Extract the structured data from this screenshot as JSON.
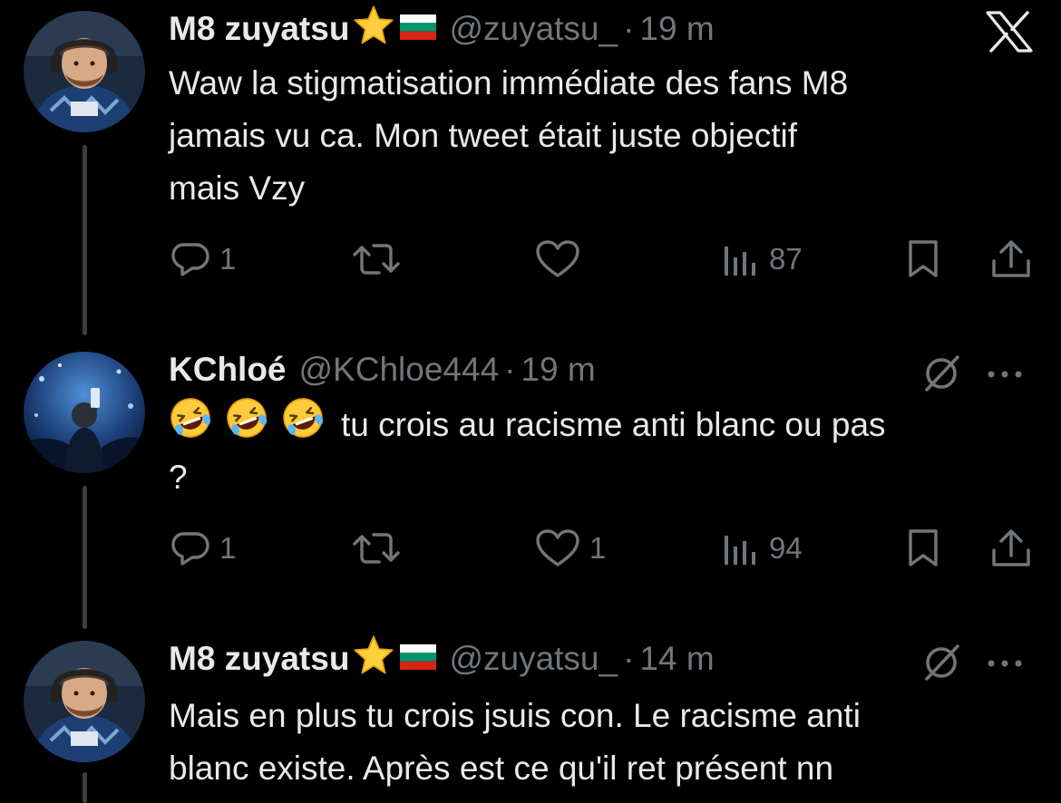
{
  "tweets": [
    {
      "name": "M8 zuyatsu",
      "handle": "@zuyatsu_",
      "separator": "·",
      "time": "19 m",
      "text_lines": [
        "Waw la stigmatisation immédiate des fans M8",
        "jamais vu ca. Mon tweet était juste objectif",
        "mais Vzy"
      ],
      "actions": {
        "replies": "1",
        "retweets": "",
        "likes": "",
        "views": "87"
      },
      "top_right_icon": "x-logo-icon"
    },
    {
      "name": "KChloé",
      "handle": "@KChloe444",
      "separator": "·",
      "time": "19 m",
      "emoji": [
        "🤣",
        "🤣",
        "🤣"
      ],
      "text_lines": [
        "tu crois au racisme anti blanc ou pas",
        "?"
      ],
      "actions": {
        "replies": "1",
        "retweets": "",
        "likes": "1",
        "views": "94"
      },
      "top_right_icon": "grok-icon"
    },
    {
      "name": "M8 zuyatsu",
      "handle": "@zuyatsu_",
      "separator": "·",
      "time": "14 m",
      "text_lines": [
        "Mais en plus tu crois jsuis con. Le racisme anti",
        "blanc existe. Après est ce qu'il ret présent nn"
      ],
      "top_right_icon": "grok-icon"
    }
  ],
  "colors": {
    "background": "#000000",
    "text": "#e7e9ea",
    "muted": "#71767b",
    "thread_line": "#3a3d41"
  }
}
